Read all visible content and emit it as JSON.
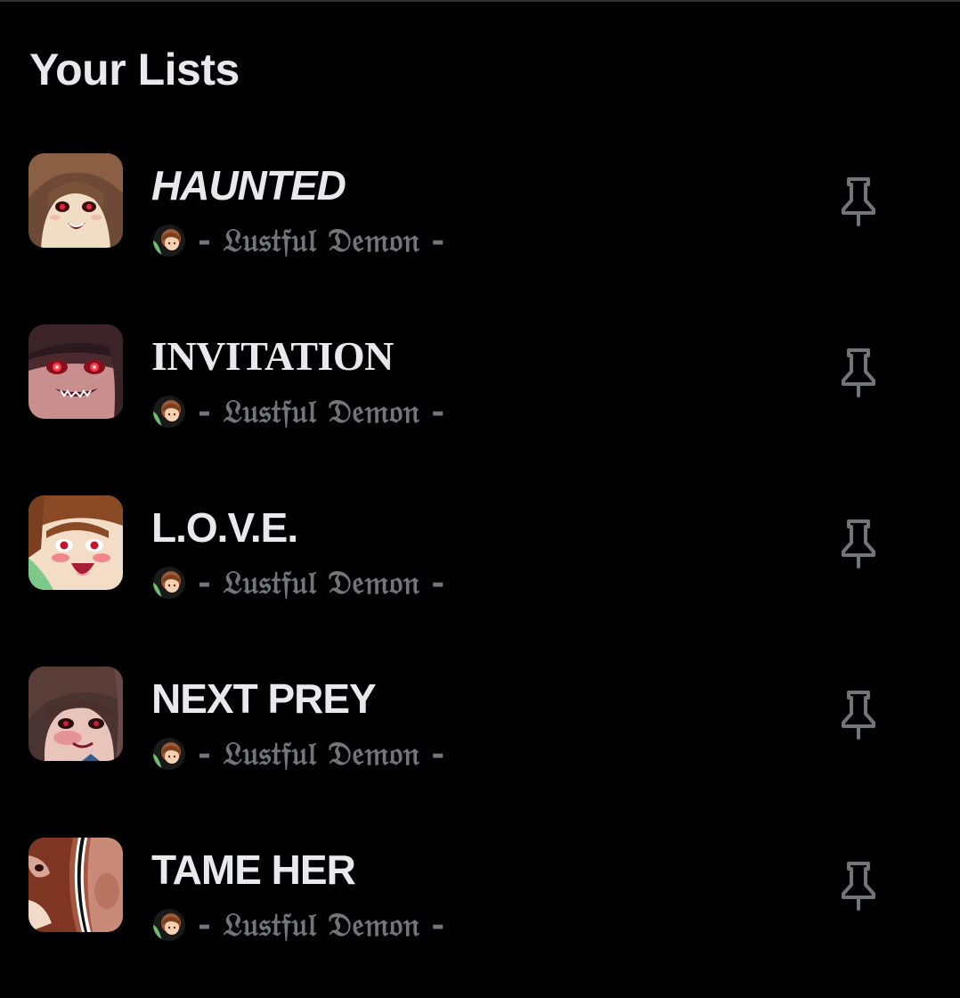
{
  "section": {
    "title": "Your Lists"
  },
  "lists": [
    {
      "name": "HAUNTED",
      "owner": "- 𝔏𝔲𝔰𝔱𝔣𝔲𝔩 𝔇𝔢𝔪𝔬𝔫 -",
      "thumbnail": "anime-avatar-red-eyes-smile",
      "pin_icon": "pin-icon"
    },
    {
      "name": "INVITATION",
      "owner": "- 𝔏𝔲𝔰𝔱𝔣𝔲𝔩 𝔇𝔢𝔪𝔬𝔫 -",
      "thumbnail": "anime-avatar-glowing-eyes-grin",
      "pin_icon": "pin-icon"
    },
    {
      "name": "L.O.V.E.",
      "owner": "- 𝔏𝔲𝔰𝔱𝔣𝔲𝔩 𝔇𝔢𝔪𝔬𝔫 -",
      "thumbnail": "anime-avatar-blush-laugh",
      "pin_icon": "pin-icon"
    },
    {
      "name": "NEXT PREY",
      "owner": "- 𝔏𝔲𝔰𝔱𝔣𝔲𝔩 𝔇𝔢𝔪𝔬𝔫 -",
      "thumbnail": "anime-avatar-dark-blush",
      "pin_icon": "pin-icon"
    },
    {
      "name": "TAME HER",
      "owner": "- 𝔏𝔲𝔰𝔱𝔣𝔲𝔩 𝔇𝔢𝔪𝔬𝔫 -",
      "thumbnail": "anime-avatar-closeup",
      "pin_icon": "pin-icon"
    }
  ],
  "colors": {
    "background": "#000000",
    "primary_text": "#e7e9ea",
    "secondary_text": "#71767b",
    "icon": "#71767b",
    "divider": "#2f3336"
  }
}
